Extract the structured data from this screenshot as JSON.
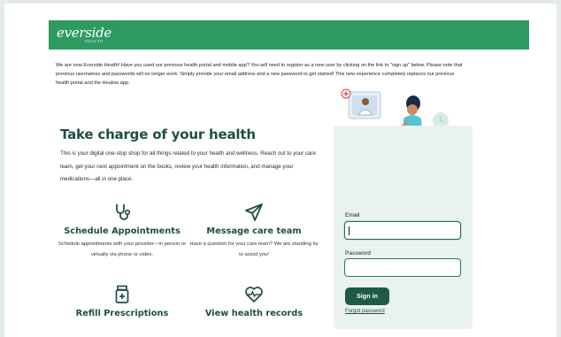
{
  "header": {
    "logo_text": "everside",
    "logo_sub": "HEALTH"
  },
  "notice": "We are now Everside Health! Have you used our previous health portal and mobile app? You will need to register as a new user by clicking on the link to \"sign up\" below. Please note that previous usernames and passwords will no longer work. Simply provide your email address and a new password to get started! This new experience completely replaces our previous health portal and the Healow app.",
  "hero": {
    "title": "Take charge of your health",
    "intro": "This is your digital one-stop shop for all things related to your health and wellness. Reach out to your care team, get your next appointment on the books, review your health information, and manage your medications—all in one place."
  },
  "features": [
    {
      "title": "Schedule Appointments",
      "description": "Schedule appointments with your provider—in person or virtually via phone or video.",
      "icon": "stethoscope-icon"
    },
    {
      "title": "Message care team",
      "description": "Have a question for your care team? We are standing by to assist you!",
      "icon": "paper-plane-icon"
    },
    {
      "title": "Refill Prescriptions",
      "description": "",
      "icon": "pill-bottle-icon"
    },
    {
      "title": "View health records",
      "description": "",
      "icon": "heart-pulse-icon"
    }
  ],
  "login": {
    "email_label": "Email",
    "email_value": "",
    "password_label": "Password",
    "password_value": "",
    "signin_label": "Sign in",
    "forgot_label": "Forgot password"
  },
  "colors": {
    "brand_green": "#2e9a62",
    "dark_green": "#1e5a44",
    "heading": "#1f4e46"
  }
}
